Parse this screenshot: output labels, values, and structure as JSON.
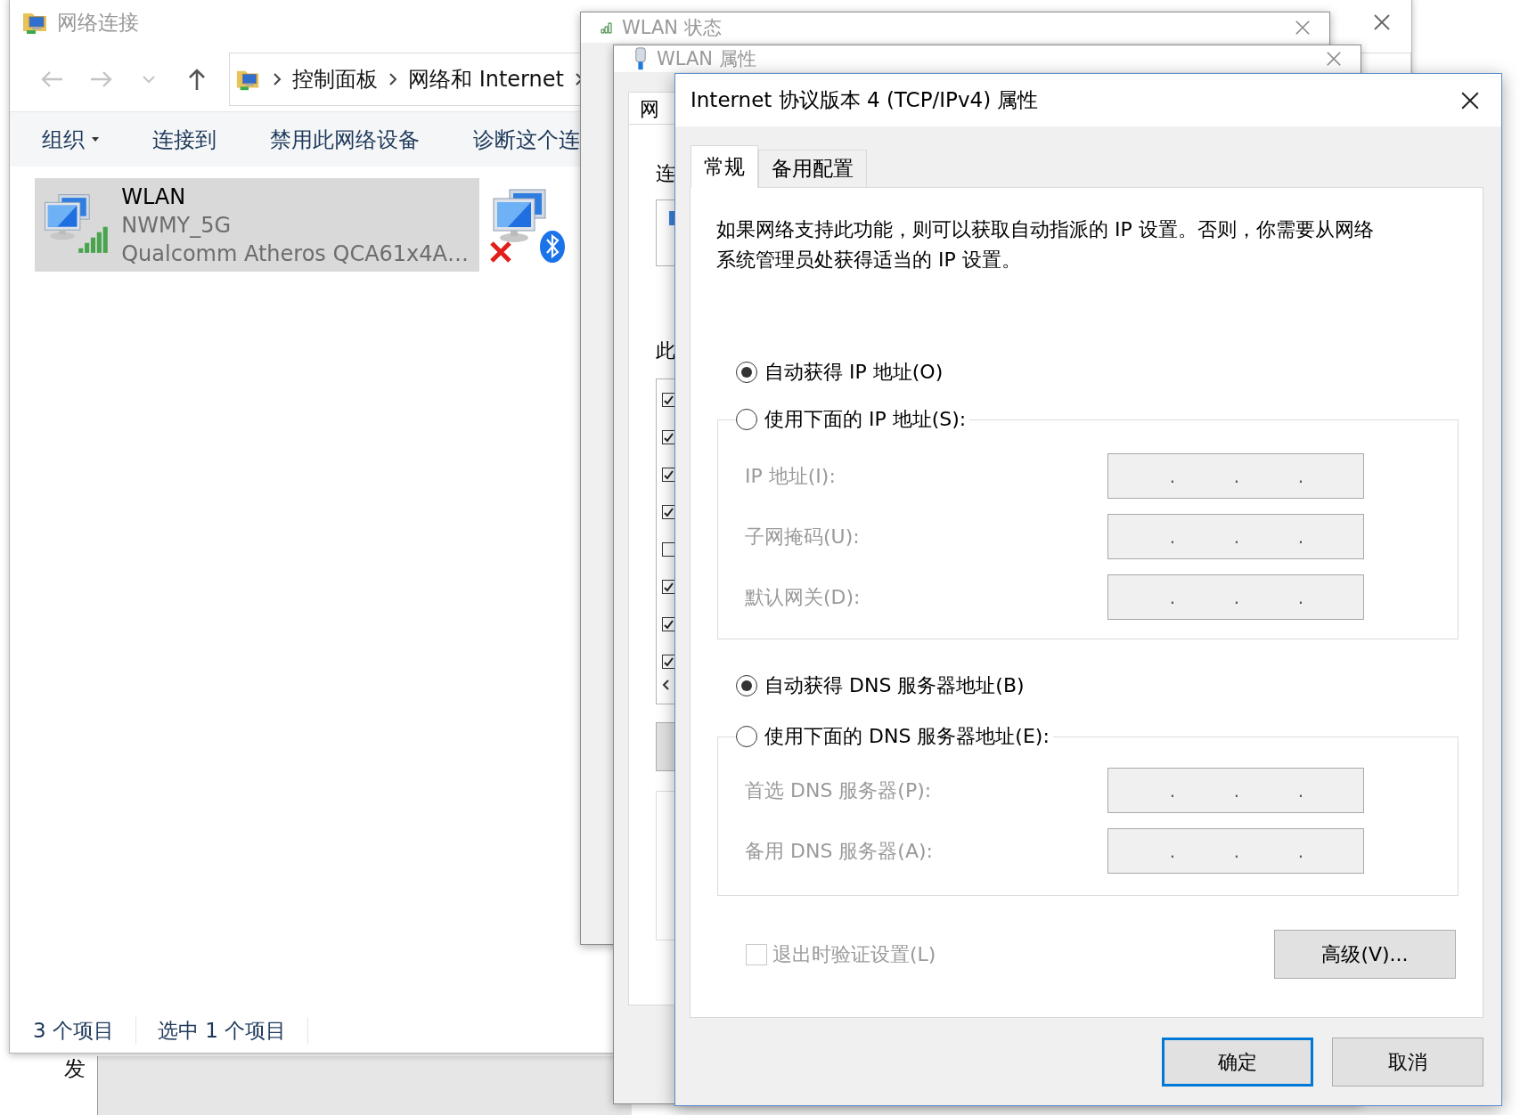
{
  "desktop": {
    "text": "发"
  },
  "explorer": {
    "title": "网络连接",
    "nav": [
      {
        "kind": "back",
        "disabled": true
      },
      {
        "kind": "forward",
        "disabled": true
      },
      {
        "kind": "recent",
        "disabled": true
      },
      {
        "kind": "up",
        "disabled": false
      }
    ],
    "breadcrumb": [
      "控制面板",
      "网络和 Internet"
    ],
    "toolbar": [
      {
        "label": "组织",
        "dropdown": true
      },
      {
        "label": "连接到",
        "dropdown": false
      },
      {
        "label": "禁用此网络设备",
        "dropdown": false
      },
      {
        "label": "诊断这个连",
        "dropdown": false
      }
    ],
    "items": [
      {
        "kind": "wifi",
        "selected": true,
        "name": "WLAN",
        "network": "NWMY_5G",
        "adapter": "Qualcomm Atheros QCA61x4A…"
      },
      {
        "kind": "bluetooth",
        "selected": false
      }
    ],
    "status": [
      "3 个项目",
      "选中 1 个项目"
    ]
  },
  "wlan_status_window": {
    "title": "WLAN 状态"
  },
  "wlan_properties_window": {
    "title": "WLAN 属性",
    "tab": "网",
    "labels": [
      "连",
      "此"
    ],
    "components": [
      {
        "checked": true
      },
      {
        "checked": true
      },
      {
        "checked": true
      },
      {
        "checked": true
      },
      {
        "checked": false
      },
      {
        "checked": true
      },
      {
        "checked": true
      },
      {
        "checked": true
      }
    ]
  },
  "ipv4_dialog": {
    "title": "Internet 协议版本 4 (TCP/IPv4) 属性",
    "tabs": [
      {
        "label": "常规",
        "selected": true
      },
      {
        "label": "备用配置",
        "selected": false
      }
    ],
    "description": "如果网络支持此功能，则可以获取自动指派的 IP 设置。否则，你需要从网络系统管理员处获得适当的 IP 设置。",
    "sections": [
      {
        "auto_option": {
          "label": "自动获得 IP 地址(O)",
          "selected": true
        },
        "manual_option": {
          "label": "使用下面的 IP 地址(S):",
          "selected": false
        },
        "fields": [
          {
            "label": "IP 地址(I):",
            "disabled": true,
            "separators": [
              ".",
              ".",
              "."
            ]
          },
          {
            "label": "子网掩码(U):",
            "disabled": true,
            "separators": [
              ".",
              ".",
              "."
            ]
          },
          {
            "label": "默认网关(D):",
            "disabled": true,
            "separators": [
              ".",
              ".",
              "."
            ]
          }
        ]
      },
      {
        "auto_option": {
          "label": "自动获得 DNS 服务器地址(B)",
          "selected": true
        },
        "manual_option": {
          "label": "使用下面的 DNS 服务器地址(E):",
          "selected": false
        },
        "fields": [
          {
            "label": "首选 DNS 服务器(P):",
            "disabled": true,
            "separators": [
              ".",
              ".",
              "."
            ]
          },
          {
            "label": "备用 DNS 服务器(A):",
            "disabled": true,
            "separators": [
              ".",
              ".",
              "."
            ]
          }
        ]
      }
    ],
    "validate_on_exit": {
      "label": "退出时验证设置(L)",
      "checked": false,
      "disabled": true
    },
    "advanced_button": "高级(V)...",
    "buttons": [
      {
        "label": "确定",
        "default": true
      },
      {
        "label": "取消",
        "default": false
      }
    ]
  }
}
